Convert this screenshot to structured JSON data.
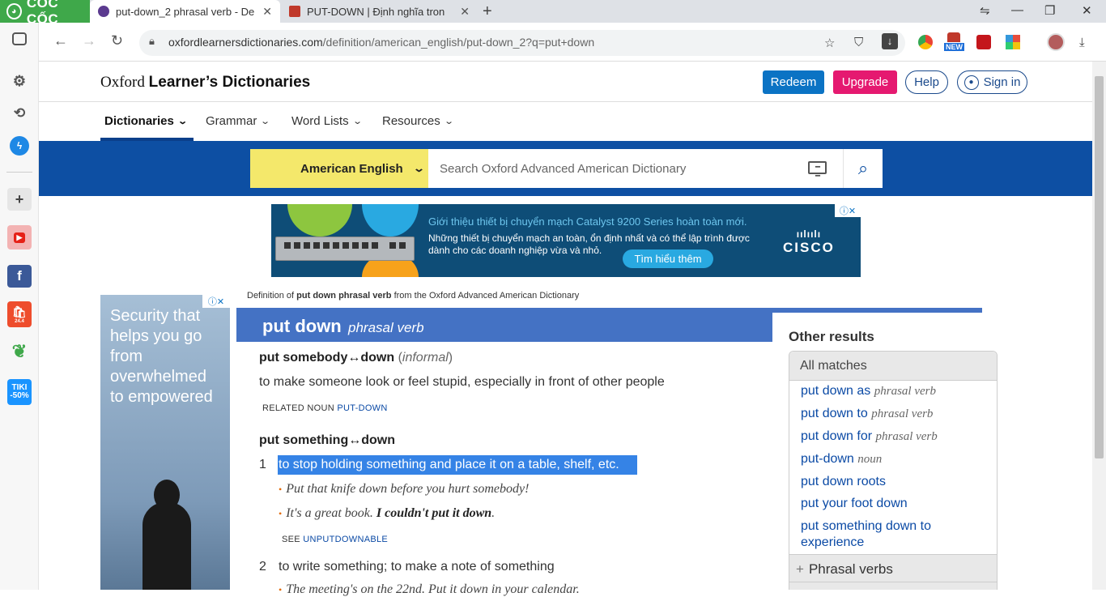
{
  "browser": {
    "brand": "CỐC CỐC",
    "tabs": [
      {
        "title": "put-down_2 phrasal verb - De",
        "favicon_color": "#5b3a8f"
      },
      {
        "title": "PUT-DOWN | Định nghĩa tron",
        "favicon_color": "#c0392b"
      }
    ],
    "url_domain": "oxfordlearnersdictionaries.com",
    "url_path": "/definition/american_english/put-down_2?q=put+down",
    "ext_new_badge": "NEW"
  },
  "sidebar": {
    "badges": [
      "24.4",
      "TIKI -50%"
    ]
  },
  "site": {
    "logo_light": "Oxford",
    "logo_bold": "Learner’s Dictionaries",
    "buttons": {
      "redeem": "Redeem",
      "upgrade": "Upgrade",
      "help": "Help",
      "signin": "Sign in"
    },
    "nav": [
      "Dictionaries",
      "Grammar",
      "Word Lists",
      "Resources"
    ],
    "search": {
      "dictionary": "American English",
      "placeholder": "Search Oxford Advanced American Dictionary"
    }
  },
  "ad_banner": {
    "headline": "Giới thiệu thiết bị chuyển mạch Catalyst 9200 Series hoàn toàn mới.",
    "body": "Những thiết bị chuyển mạch an toàn, ổn định nhất và có thể lập trình được dành cho các doanh nghiệp vừa và nhỏ.",
    "cta": "Tìm hiểu thêm",
    "brand": "CISCO"
  },
  "side_ad": {
    "text": "Security that helps you go from overwhelmed to empowered"
  },
  "entry": {
    "source_prefix": "Definition of",
    "source_term": "put down phrasal verb",
    "source_suffix": "from the Oxford Advanced American Dictionary",
    "headword": "put down",
    "pos": "phrasal verb",
    "sense_a": {
      "pattern": "put somebody↔down",
      "label_open": "(",
      "label": "informal",
      "label_close": ")",
      "definition": "to make someone look or feel stupid, especially in front of other people",
      "related_label": "RELATED NOUN",
      "related_link": "PUT-DOWN"
    },
    "sense_b": {
      "pattern": "put something↔down",
      "senses": [
        {
          "num": "1",
          "definition": "to stop holding something and place it on a table, shelf, etc.",
          "examples": [
            {
              "text": "Put that knife down before you hurt somebody!",
              "bold": ""
            },
            {
              "text": "It's a great book.",
              "bold": "I couldn't put it down"
            }
          ],
          "see_label": "SEE",
          "see_link": "UNPUTDOWNABLE"
        },
        {
          "num": "2",
          "definition": "to write something; to make a note of something",
          "example_partial": "The meeting's on the 22nd. Put it down in your calendar."
        }
      ]
    }
  },
  "other_results": {
    "title": "Other results",
    "all_matches": "All matches",
    "items": [
      {
        "word": "put down as",
        "pos": "phrasal verb"
      },
      {
        "word": "put down to",
        "pos": "phrasal verb"
      },
      {
        "word": "put down for",
        "pos": "phrasal verb"
      },
      {
        "word": "put-down",
        "pos": "noun"
      },
      {
        "word": "put down roots",
        "pos": ""
      },
      {
        "word": "put your foot down",
        "pos": ""
      },
      {
        "word": "put something down to experience",
        "pos": ""
      }
    ],
    "phrasal_verbs": "Phrasal verbs"
  }
}
